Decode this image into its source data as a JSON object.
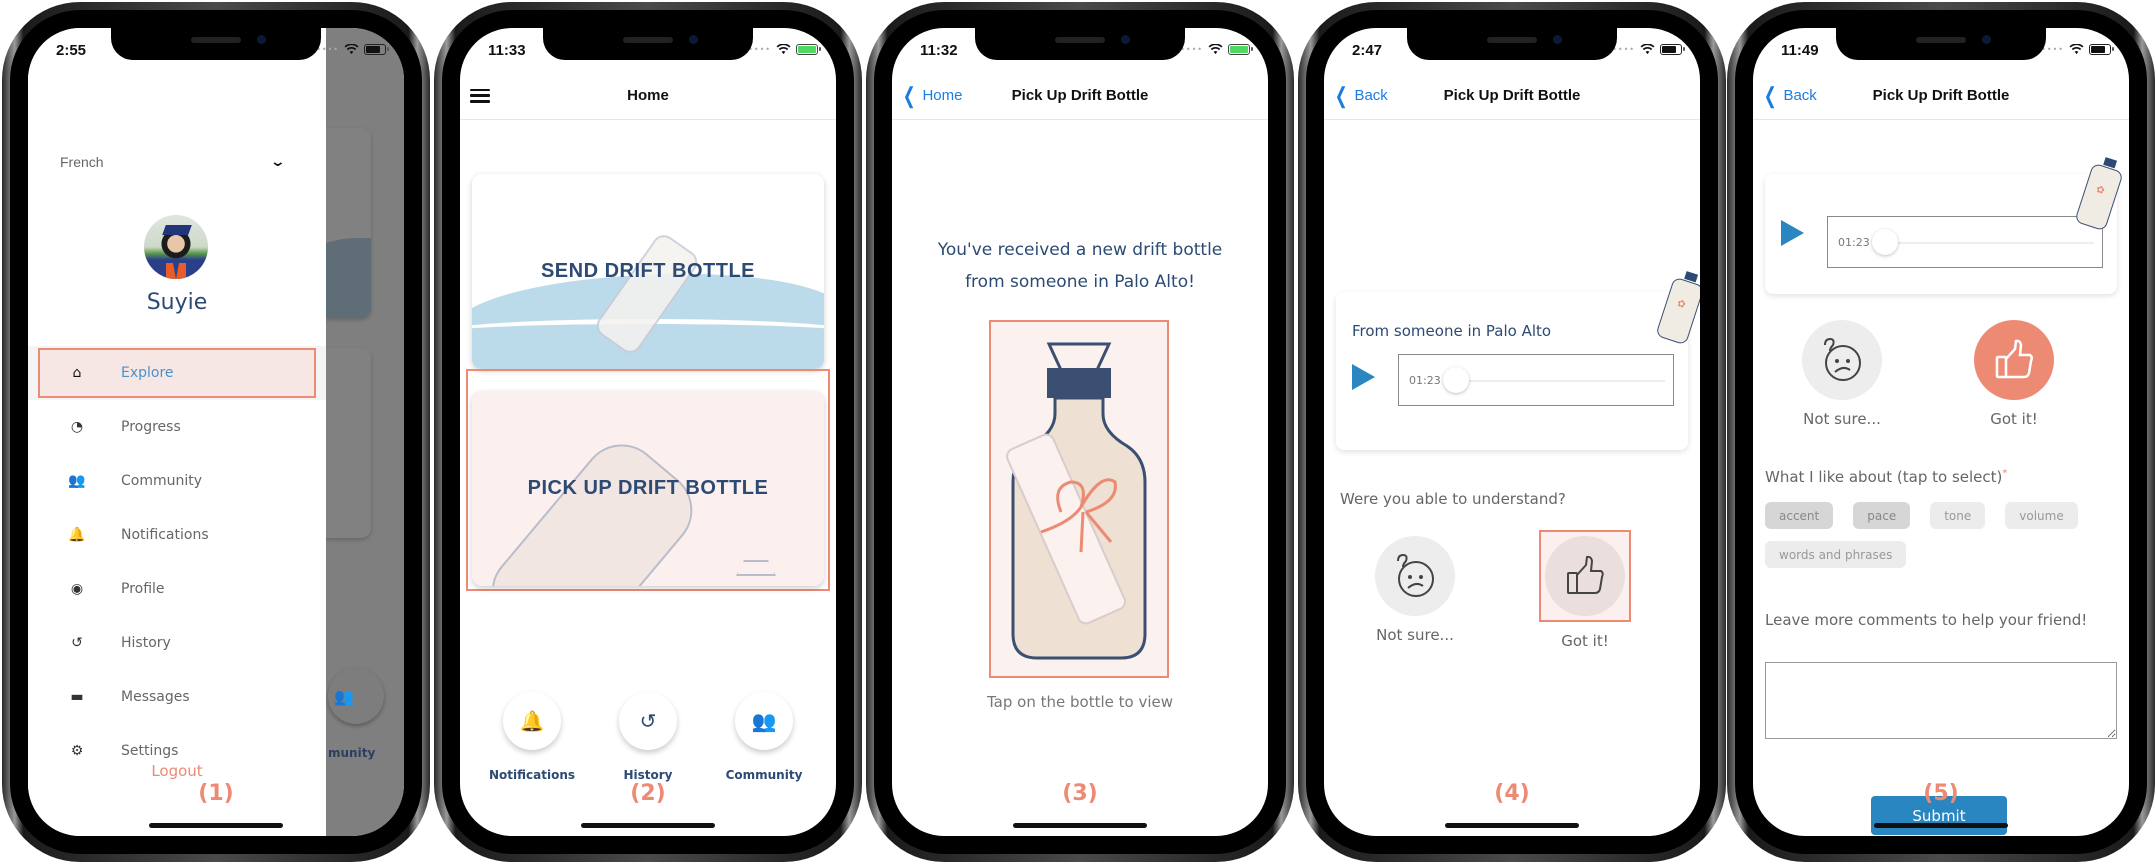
{
  "colors": {
    "accent_coral": "#ec8a74",
    "navy": "#2c4a73",
    "ios_blue": "#1a7de4",
    "play_blue": "#2986c0",
    "highlight_bg": "#fbf0ee"
  },
  "screens": [
    {
      "step": "(1)",
      "status": {
        "time": "2:55",
        "battery": "normal"
      },
      "language": {
        "selected": "French",
        "icon": "chevron-down-icon"
      },
      "profile": {
        "name": "Suyie",
        "avatar": "avatar-photo"
      },
      "menu": [
        {
          "label": "Explore",
          "icon": "home-icon",
          "glyph": "⌂",
          "active": true
        },
        {
          "label": "Progress",
          "icon": "gauge-icon",
          "glyph": "◔"
        },
        {
          "label": "Community",
          "icon": "group-icon",
          "glyph": "👥"
        },
        {
          "label": "Notifications",
          "icon": "bell-icon",
          "glyph": "🔔"
        },
        {
          "label": "Profile",
          "icon": "user-circle-icon",
          "glyph": "◉"
        },
        {
          "label": "History",
          "icon": "history-icon",
          "glyph": "↺"
        },
        {
          "label": "Messages",
          "icon": "chat-icon",
          "glyph": "▬"
        },
        {
          "label": "Settings",
          "icon": "gear-icon",
          "glyph": "⚙"
        }
      ],
      "logout_label": "Logout",
      "background_partial_label": "munity"
    },
    {
      "step": "(2)",
      "status": {
        "time": "11:33",
        "battery": "charging"
      },
      "nav": {
        "title": "Home",
        "menu_icon": "hamburger-icon"
      },
      "cards": [
        {
          "title": "SEND DRIFT BOTTLE"
        },
        {
          "title": "PICK UP DRIFT BOTTLE",
          "highlighted": true
        }
      ],
      "quick_actions": [
        {
          "label": "Notifications",
          "icon": "bell-icon",
          "glyph": "🔔"
        },
        {
          "label": "History",
          "icon": "history-icon",
          "glyph": "↺"
        },
        {
          "label": "Community",
          "icon": "group-icon",
          "glyph": "👥"
        }
      ]
    },
    {
      "step": "(3)",
      "status": {
        "time": "11:32",
        "battery": "charging"
      },
      "nav": {
        "back_label": "Home",
        "title": "Pick Up Drift Bottle"
      },
      "message_line1": "You've received a new drift bottle",
      "message_line2": "from someone in Palo Alto!",
      "tap_hint": "Tap on the bottle to view"
    },
    {
      "step": "(4)",
      "status": {
        "time": "2:47",
        "battery": "normal"
      },
      "nav": {
        "back_label": "Back",
        "title": "Pick Up Drift Bottle"
      },
      "from_label": "From someone in Palo Alto",
      "audio": {
        "time": "01:23",
        "progress": 0
      },
      "question": "Were you able to understand?",
      "ratings": [
        {
          "label": "Not sure...",
          "icon": "confused-face-icon"
        },
        {
          "label": "Got it!",
          "icon": "thumbs-up-icon",
          "highlighted": true
        }
      ]
    },
    {
      "step": "(5)",
      "status": {
        "time": "11:49",
        "battery": "normal"
      },
      "nav": {
        "back_label": "Back",
        "title": "Pick Up Drift Bottle"
      },
      "audio": {
        "time": "01:23",
        "progress": 0
      },
      "ratings": [
        {
          "label": "Not sure...",
          "icon": "confused-face-icon"
        },
        {
          "label": "Got it!",
          "icon": "thumbs-up-icon",
          "selected": true
        }
      ],
      "like_label": "What I like about (tap to select)",
      "required_mark": "*",
      "chips": [
        {
          "label": "accent",
          "selected": true
        },
        {
          "label": "pace",
          "selected": true
        },
        {
          "label": "tone",
          "selected": false
        },
        {
          "label": "volume",
          "selected": false
        },
        {
          "label": "words and phrases",
          "selected": false
        }
      ],
      "comment_label": "Leave more comments to help your friend!",
      "comment_value": "",
      "submit_label": "Submit"
    }
  ]
}
